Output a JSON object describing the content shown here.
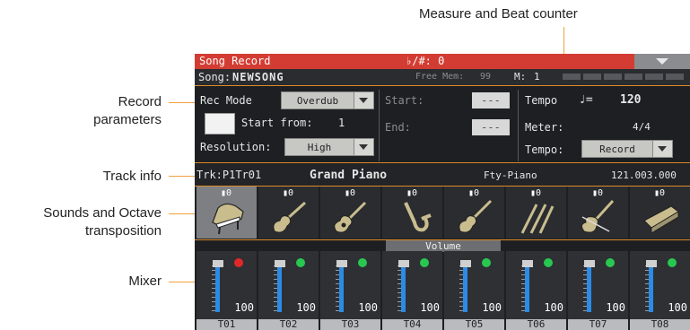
{
  "callouts": {
    "measure_counter": "Measure and Beat counter",
    "record_parameters_1": "Record",
    "record_parameters_2": "parameters",
    "track_info": "Track info",
    "sounds_octave_1": "Sounds and Octave",
    "sounds_octave_2": "transposition",
    "mixer": "Mixer"
  },
  "screen": {
    "title": "Song Record",
    "accidentals": "♭/#:  0",
    "song_label": "Song:",
    "song_name": "NEWSONG",
    "free_mem_label": "Free Mem:",
    "free_mem_value": "99",
    "measure_label": "M:",
    "measure_value": "1",
    "rec_mode_label": "Rec Mode",
    "rec_mode_value": "Overdub",
    "start_from_label": "Start from:",
    "start_from_value": "1",
    "resolution_label": "Resolution:",
    "resolution_value": "High",
    "start_label": "Start:",
    "start_value": "---",
    "end_label": "End:",
    "end_value": "---",
    "tempo_label": "Tempo",
    "tempo_note": "♩=",
    "tempo_value": "120",
    "meter_label": "Meter:",
    "meter_value": "4/4",
    "tempo_mode_label": "Tempo:",
    "tempo_mode_value": "Record",
    "track_id": "Trk:P1Tr01",
    "track_sound": "Grand Piano",
    "track_category": "Fty-Piano",
    "track_bank": "121.003.000",
    "volume_tab": "Volume",
    "octave_text": "0"
  },
  "tracks": [
    {
      "channel": "T01",
      "icon": "grand-piano-icon",
      "volume": "100",
      "led": "#e02828"
    },
    {
      "channel": "T02",
      "icon": "electric-guitar-icon",
      "volume": "100",
      "led": "#28c850"
    },
    {
      "channel": "T03",
      "icon": "acoustic-guitar-icon",
      "volume": "100",
      "led": "#28c850"
    },
    {
      "channel": "T04",
      "icon": "saxophone-icon",
      "volume": "100",
      "led": "#28c850"
    },
    {
      "channel": "T05",
      "icon": "bass-guitar-icon",
      "volume": "100",
      "led": "#28c850"
    },
    {
      "channel": "T06",
      "icon": "drumsticks-icon",
      "volume": "100",
      "led": "#28c850"
    },
    {
      "channel": "T07",
      "icon": "violin-icon",
      "volume": "100",
      "led": "#28c850"
    },
    {
      "channel": "T08",
      "icon": "keyboard-icon",
      "volume": "100",
      "led": "#28c850"
    }
  ],
  "colors": {
    "titlebar": "#d33c32",
    "accent": "#e08a2a",
    "fader": "#2b8be6"
  }
}
